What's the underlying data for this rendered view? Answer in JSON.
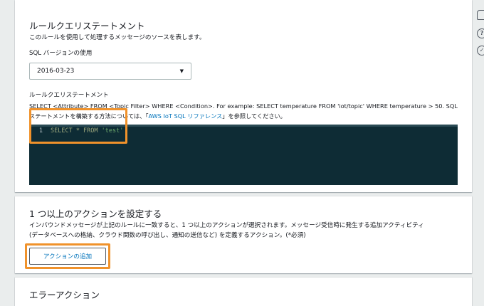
{
  "rule_query": {
    "title": "ルールクエリステートメント",
    "description": "このルールを使用して処理するメッセージのソースを表します。",
    "sql_version_label": "SQL バージョンの使用",
    "sql_version_value": "2016-03-23",
    "statement_label": "ルールクエリステートメント",
    "help_line1": "SELECT <Attribute> FROM <Topic Filter> WHERE <Condition>. For example: SELECT temperature FROM 'iot/topic' WHERE temperature > 50. SQL",
    "help_line2_pre": "ステートメントを構築する方法については、「",
    "help_link": "AWS IoT SQL リファレンス",
    "help_line2_post": "」を参照してください。",
    "editor": {
      "line_number": "1",
      "code_keyword1": "SELECT * FROM ",
      "code_string": "'test'"
    }
  },
  "actions": {
    "title": "1 つ以上のアクションを設定する",
    "description_line1": "インバウンドメッセージが上記のルールに一致すると、1 つ以上のアクションが選択されます。メッセージ受信時に発生する追加アクティビティ",
    "description_line2": "(データベースへの格納、クラウド関数の呼び出し、通知の送信など) を定義するアクション。(*必須)",
    "add_button": "アクションの追加"
  },
  "error_action": {
    "title": "エラーアクション"
  },
  "side_icons": [
    "bell-icon",
    "help-icon",
    "check-circle-icon"
  ],
  "colors": {
    "highlight": "#f0922b",
    "link": "#0073bb",
    "editor_bg": "#0e2c35"
  }
}
